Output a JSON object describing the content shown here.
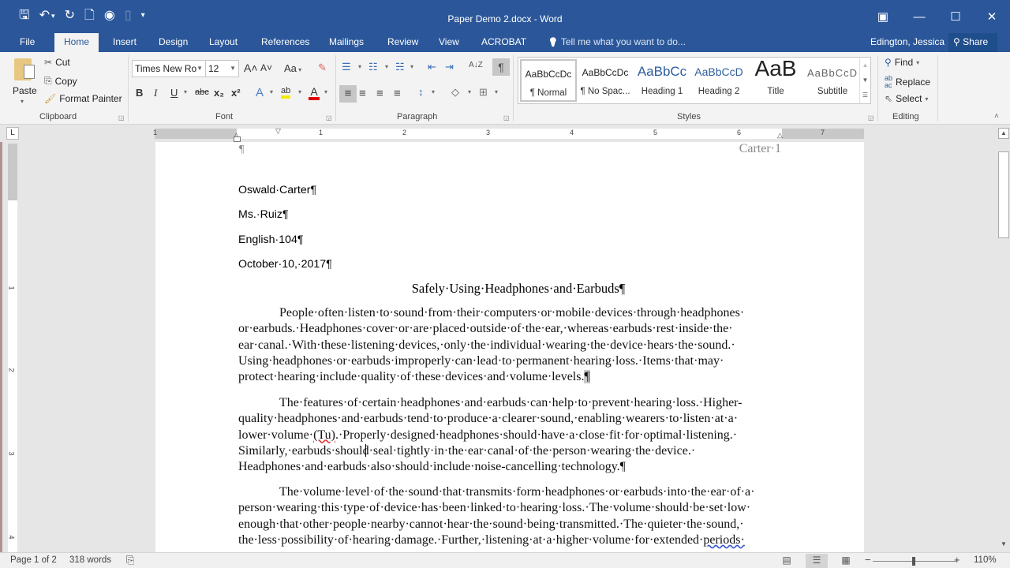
{
  "window": {
    "title": "Paper Demo 2.docx - Word",
    "controls": {
      "ribbon_display": "▣",
      "minimize": "—",
      "maximize": "☐",
      "close": "✕"
    }
  },
  "qat": {
    "save_icon": "🖫",
    "undo_icon": "↶",
    "undo_dd": "▾",
    "redo_icon": "↻",
    "print_preview_icon": "🗋",
    "touch_mode_icon": "◉",
    "disabled_icon": "▯",
    "customize_icon": "▾"
  },
  "tabs": [
    "File",
    "Home",
    "Insert",
    "Design",
    "Layout",
    "References",
    "Mailings",
    "Review",
    "View",
    "ACROBAT"
  ],
  "tellme": {
    "icon": "💡",
    "placeholder": "Tell me what you want to do..."
  },
  "user": {
    "name": "Edington, Jessica",
    "share_label": "Share",
    "share_icon": "⚲"
  },
  "ribbon": {
    "clipboard": {
      "label": "Clipboard",
      "paste": "Paste",
      "cut": "Cut",
      "copy": "Copy",
      "format_painter": "Format Painter"
    },
    "font": {
      "label": "Font",
      "font_name": "Times New Ro",
      "font_size": "12",
      "grow": "A˄",
      "shrink": "A˅",
      "change_case": "Aa",
      "clear": "✎",
      "bold": "B",
      "italic": "I",
      "underline": "U",
      "strike": "abc",
      "subscript": "x₂",
      "superscript": "x²",
      "text_effects": "A",
      "highlight": "ab",
      "font_color": "A",
      "highlight_color": "#f5e800",
      "font_color_value": "#e00000"
    },
    "paragraph": {
      "label": "Paragraph",
      "bullets": "☰",
      "numbering": "☷",
      "multilevel": "☵",
      "decrease_indent": "⇤",
      "increase_indent": "⇥",
      "sort": "A↓Z",
      "show_marks": "¶",
      "align_left": "≡",
      "center": "≡",
      "align_right": "≡",
      "justify": "≡",
      "line_spacing": "↕",
      "shading": "◇",
      "borders": "⊞"
    },
    "styles": {
      "label": "Styles",
      "items": [
        {
          "preview": "AaBbCcDc",
          "name": "¶ Normal"
        },
        {
          "preview": "AaBbCcDc",
          "name": "¶ No Spac..."
        },
        {
          "preview": "AaBbCc",
          "name": "Heading 1"
        },
        {
          "preview": "AaBbCcD",
          "name": "Heading 2"
        },
        {
          "preview": "AaB",
          "name": "Title"
        },
        {
          "preview": "AaBbCcD",
          "name": "Subtitle"
        }
      ]
    },
    "editing": {
      "label": "Editing",
      "find": "Find",
      "replace": "Replace",
      "select": "Select"
    }
  },
  "ruler": {
    "h_numbers": [
      "1",
      "1",
      "2",
      "3",
      "4",
      "5",
      "6",
      "7"
    ],
    "v_numbers": [
      "1",
      "2",
      "3",
      "4"
    ],
    "tab_selector": "L"
  },
  "document": {
    "header": "Carter·1",
    "header_pilcrow": "¶",
    "heading_lines": [
      "Oswald·Carter¶",
      "Ms.·Ruiz¶",
      "English·104¶",
      "October·10,·2017¶"
    ],
    "title": "Safely·Using·Headphones·and·Earbuds¶",
    "p1": [
      "People·often·listen·to·sound·from·their·computers·or·mobile·devices·through·headphones·",
      "or·earbuds.·Headphones·cover·or·are·placed·outside·of·the·ear,·whereas·earbuds·rest·inside·the·",
      "ear·canal.·With·these·listening·devices,·only·the·individual·wearing·the·device·hears·the·sound.·",
      "Using·headphones·or·earbuds·improperly·can·lead·to·permanent·hearing·loss.·Items·that·may·",
      "protect·hearing·include·quality·of·these·devices·and·volume·levels."
    ],
    "p1_end": "¶",
    "p2": [
      "The·features·of·certain·headphones·and·earbuds·can·help·to·prevent·hearing·loss.·Higher-",
      "quality·headphones·and·earbuds·tend·to·produce·a·clearer·sound,·enabling·wearers·to·listen·at·a·"
    ],
    "p2_l3_a": "lower·volume·",
    "p2_l3_err": "(Tu)",
    "p2_l3_b": ".·Properly·designed·headphones·should·have·a·close·fit·for·optimal·listening.·",
    "p2_rest": [
      "Similarly,·earbuds·should·seal·tightly·in·the·ear·canal·of·the·person·wearing·the·device.·",
      "Headphones·and·earbuds·also·should·include·noise-cancelling·technology.¶"
    ],
    "p3": [
      "The·volume·level·of·the·sound·that·transmits·form·headphones·or·earbuds·into·the·ear·of·a·",
      "person·wearing·this·type·of·device·has·been·linked·to·hearing·loss.·The·volume·should·be·set·low·",
      "enough·that·other·people·nearby·cannot·hear·the·sound·being·transmitted.·The·quieter·the·sound,·"
    ],
    "p3_l4_a": "the·less·possibility·of·hearing·damage.·Further,·listening·at·a·higher·volume·for·extended·",
    "p3_l4_err": "periods·"
  },
  "status": {
    "page": "Page 1 of 2",
    "words": "318 words",
    "proofing_icon": "⎘",
    "zoom": "110%",
    "zoom_minus": "−",
    "zoom_plus": "+",
    "zoom_fraction": 0.55
  }
}
